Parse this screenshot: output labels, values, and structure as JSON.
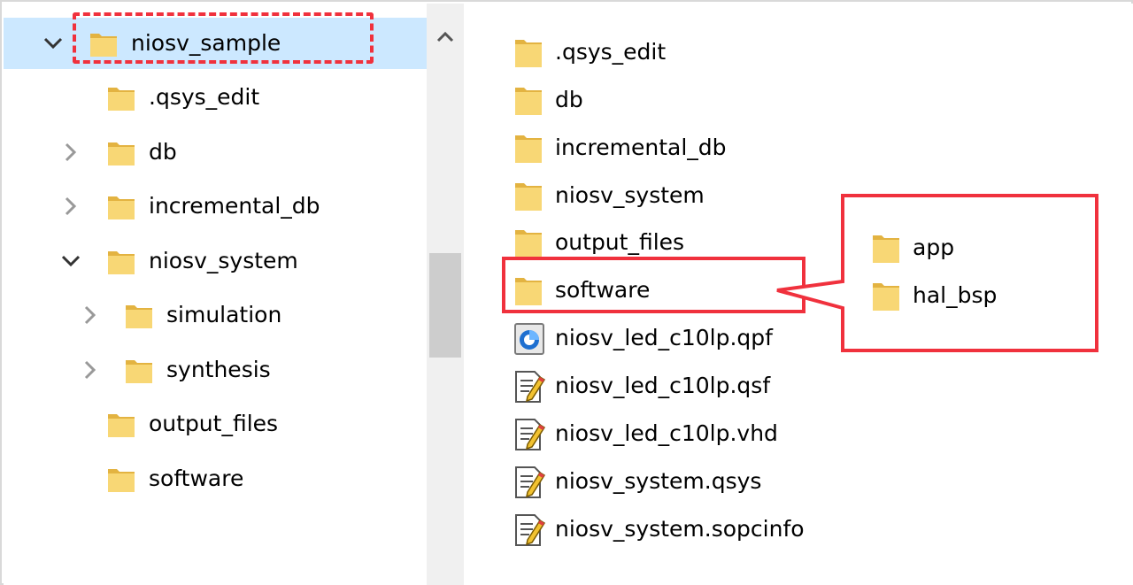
{
  "tree": {
    "items": [
      {
        "label": "niosv_sample",
        "expanded": true,
        "selected": true
      },
      {
        "label": ".qsys_edit"
      },
      {
        "label": "db",
        "expandable": true
      },
      {
        "label": "incremental_db",
        "expandable": true
      },
      {
        "label": "niosv_system",
        "expanded": true
      },
      {
        "label": "simulation",
        "expandable": true
      },
      {
        "label": "synthesis",
        "expandable": true
      },
      {
        "label": "output_files"
      },
      {
        "label": "software"
      }
    ]
  },
  "content": {
    "items": [
      {
        "label": ".qsys_edit",
        "icon": "folder-icon"
      },
      {
        "label": "db",
        "icon": "folder-icon"
      },
      {
        "label": "incremental_db",
        "icon": "folder-icon"
      },
      {
        "label": "niosv_system",
        "icon": "folder-icon"
      },
      {
        "label": "output_files",
        "icon": "folder-icon"
      },
      {
        "label": "software",
        "icon": "folder-icon"
      },
      {
        "label": "niosv_led_c10lp.qpf",
        "icon": "quartus-project-icon"
      },
      {
        "label": "niosv_led_c10lp.qsf",
        "icon": "text-file-icon"
      },
      {
        "label": "niosv_led_c10lp.vhd",
        "icon": "text-file-icon"
      },
      {
        "label": "niosv_system.qsys",
        "icon": "text-file-icon"
      },
      {
        "label": "niosv_system.sopcinfo",
        "icon": "text-file-icon"
      }
    ]
  },
  "callout": {
    "items": [
      {
        "label": "app",
        "icon": "folder-icon"
      },
      {
        "label": "hal_bsp",
        "icon": "folder-icon"
      }
    ]
  },
  "colors": {
    "highlight": "#f0313d",
    "selection": "#cce8ff",
    "folder": "#f8d775",
    "folder_dark": "#e3b341"
  }
}
